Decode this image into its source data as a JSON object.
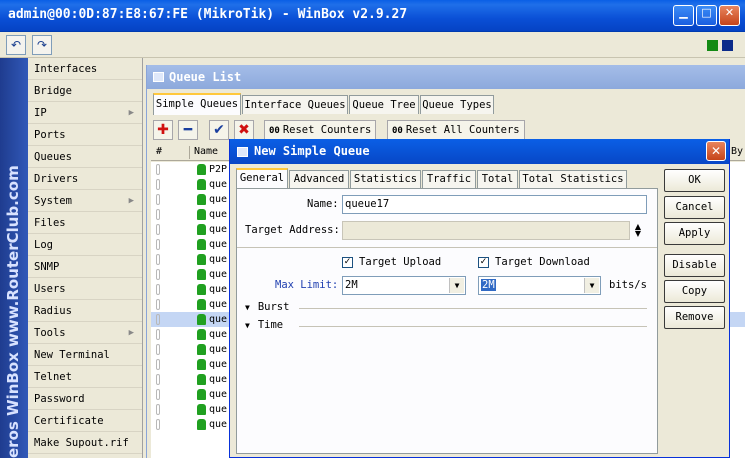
{
  "window": {
    "title": "admin@00:0D:87:E8:67:FE (MikroTik) - WinBox v2.9.27"
  },
  "toolbar": {
    "undo_icon": "undo-icon",
    "redo_icon": "redo-icon",
    "status_colors": [
      "#138a13",
      "#0b2b8a"
    ]
  },
  "brand_vertical": "eros WinBox   www.RouterClub.com",
  "sidebar": {
    "items": [
      {
        "label": "Interfaces"
      },
      {
        "label": "Bridge"
      },
      {
        "label": "IP",
        "submenu": true
      },
      {
        "label": "Ports"
      },
      {
        "label": "Queues"
      },
      {
        "label": "Drivers"
      },
      {
        "label": "System",
        "submenu": true
      },
      {
        "label": "Files"
      },
      {
        "label": "Log"
      },
      {
        "label": "SNMP"
      },
      {
        "label": "Users"
      },
      {
        "label": "Radius"
      },
      {
        "label": "Tools",
        "submenu": true
      },
      {
        "label": "New Terminal"
      },
      {
        "label": "Telnet"
      },
      {
        "label": "Password"
      },
      {
        "label": "Certificate"
      },
      {
        "label": "Make Supout.rif"
      }
    ]
  },
  "queue_list": {
    "title": "Queue List",
    "tabs": [
      "Simple Queues",
      "Interface Queues",
      "Queue Tree",
      "Queue Types"
    ],
    "buttons": {
      "reset_counters": "Reset Counters",
      "reset_all_counters": "Reset All Counters",
      "counter_prefix": "00"
    },
    "columns": {
      "num": "#",
      "name": "Name",
      "extra": "By"
    },
    "rows": [
      "P2P",
      "que",
      "que",
      "que",
      "que",
      "que",
      "que",
      "que",
      "que",
      "que",
      "que",
      "que",
      "que",
      "que",
      "que",
      "que",
      "que",
      "que"
    ],
    "selected_row_index": 10
  },
  "dialog": {
    "title": "New Simple Queue",
    "tabs": [
      "General",
      "Advanced",
      "Statistics",
      "Traffic",
      "Total",
      "Total Statistics"
    ],
    "name_label": "Name:",
    "name_value": "queue17",
    "target_address_label": "Target Address:",
    "target_upload_label": "Target Upload",
    "target_download_label": "Target Download",
    "target_upload_checked": true,
    "target_download_checked": true,
    "max_limit_label": "Max Limit:",
    "max_limit_upload": "2M",
    "max_limit_download": "2M",
    "units": "bits/s",
    "sections": [
      "Burst",
      "Time"
    ],
    "buttons": [
      "OK",
      "Cancel",
      "Apply",
      "Disable",
      "Copy",
      "Remove"
    ]
  }
}
